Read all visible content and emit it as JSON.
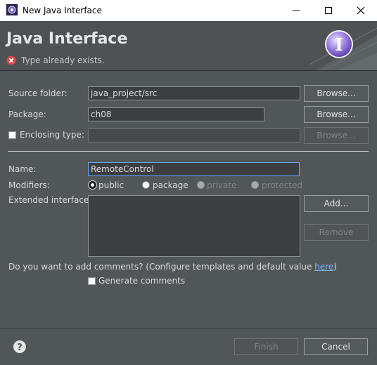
{
  "window": {
    "title": "New Java Interface",
    "icon": "eclipse-new-interface-icon",
    "controls": {
      "minimize": "minimize-icon",
      "maximize": "maximize-icon",
      "close": "close-icon"
    }
  },
  "banner": {
    "title": "Java Interface",
    "error_message": "Type already exists.",
    "error_icon": "error-icon",
    "glyph": "I"
  },
  "form": {
    "source_folder": {
      "label": "Source folder:",
      "value": "java_project/src",
      "button": "Browse..."
    },
    "package": {
      "label": "Package:",
      "value": "ch08",
      "button": "Browse..."
    },
    "enclosing_type": {
      "label": "Enclosing type:",
      "checked": false,
      "value": "",
      "button": "Browse..."
    },
    "name": {
      "label": "Name:",
      "value": "RemoteControl"
    },
    "modifiers": {
      "label": "Modifiers:",
      "options": [
        {
          "label": "public",
          "selected": true,
          "enabled": true
        },
        {
          "label": "package",
          "selected": false,
          "enabled": true
        },
        {
          "label": "private",
          "selected": false,
          "enabled": false
        },
        {
          "label": "protected",
          "selected": false,
          "enabled": false
        }
      ]
    },
    "extended_interfaces": {
      "label": "Extended interfaces:",
      "items": [],
      "add_button": "Add...",
      "remove_button": "Remove"
    },
    "comments": {
      "question": "Do you want to add comments? (Configure templates and default value ",
      "link": "here",
      "question_end": ")",
      "generate_label": "Generate comments",
      "checked": false
    }
  },
  "footer": {
    "finish_button": "Finish",
    "cancel_button": "Cancel",
    "finish_enabled": false,
    "help_icon": "help-icon"
  },
  "colors": {
    "background": "#515658",
    "field": "#3c3f41",
    "focus_border": "#65a7ff",
    "error": "#d64b4b",
    "link": "#79b8ff"
  }
}
